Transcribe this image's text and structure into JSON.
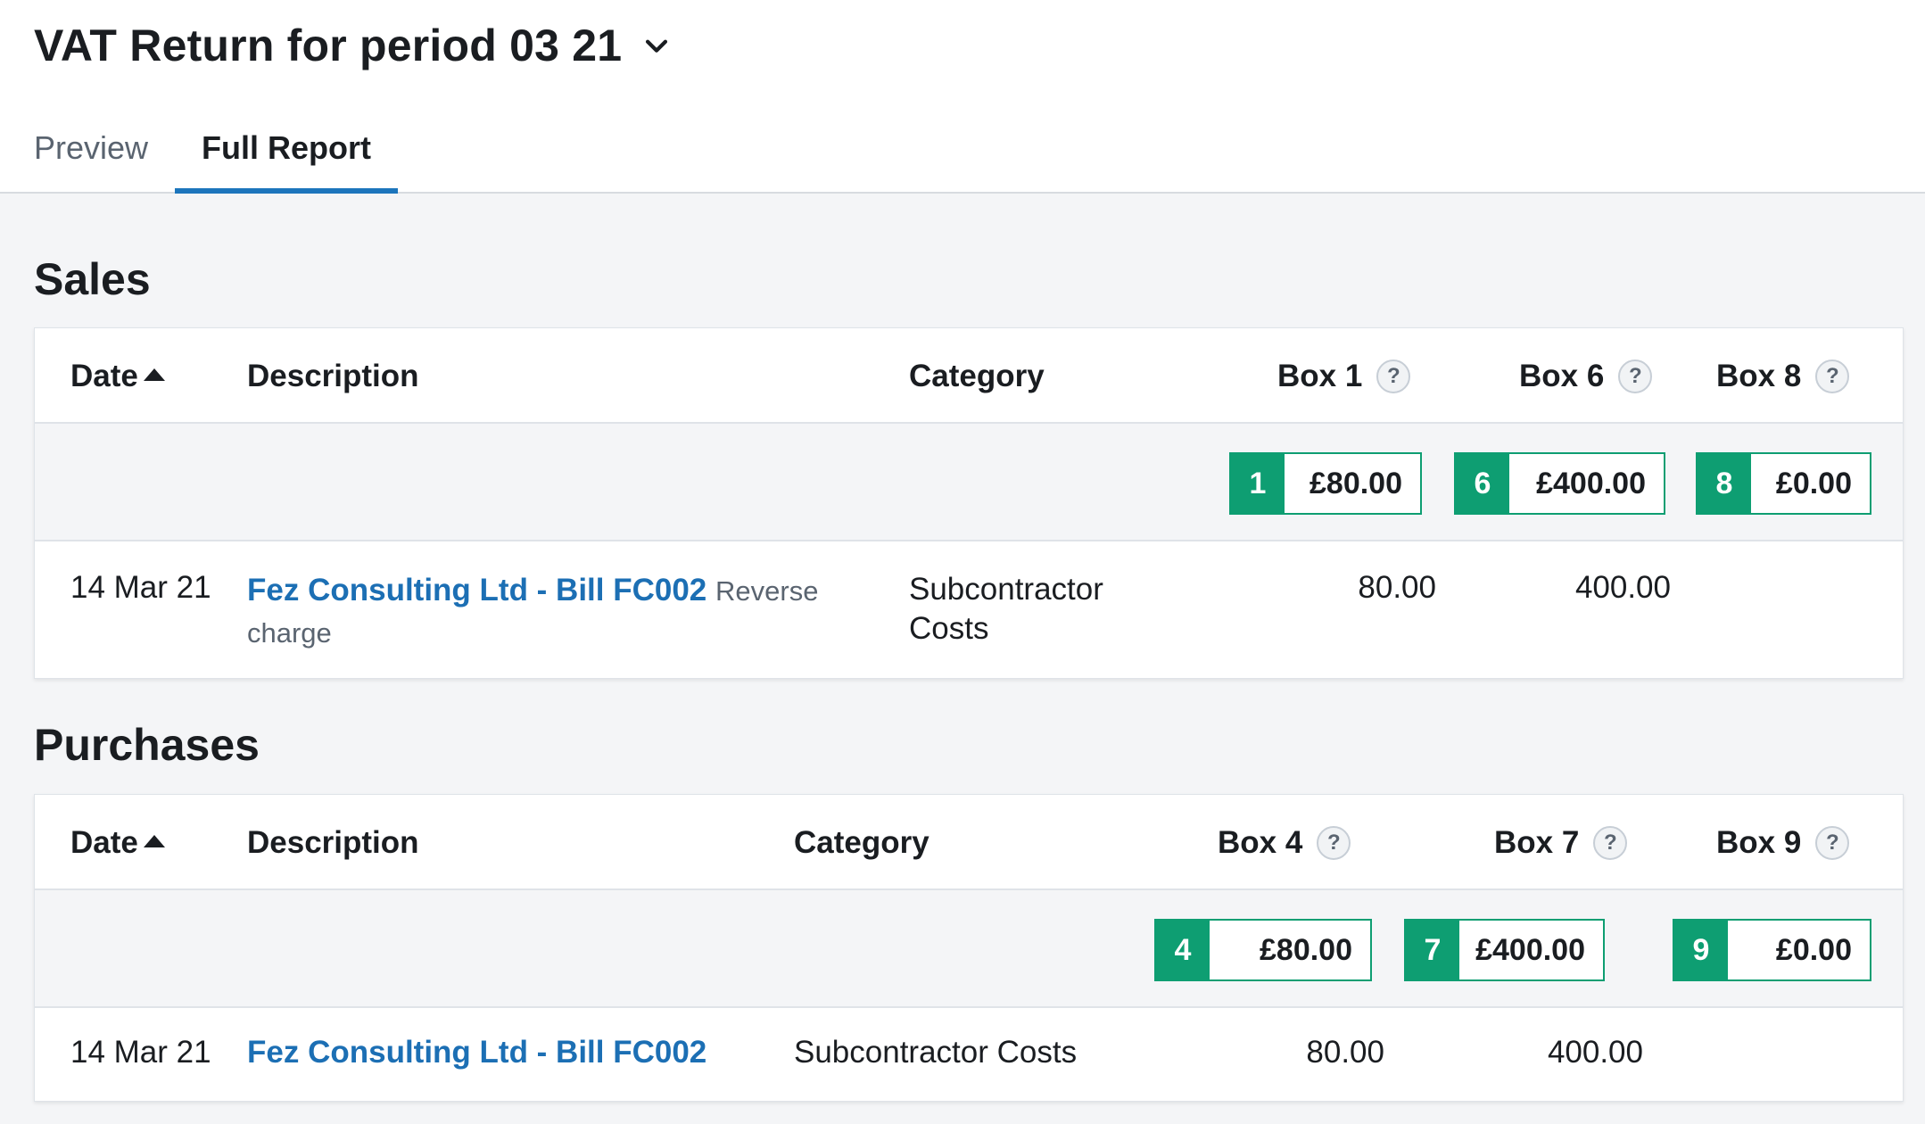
{
  "header": {
    "title": "VAT Return for period 03 21",
    "tabs": [
      {
        "label": "Preview",
        "active": false
      },
      {
        "label": "Full Report",
        "active": true
      }
    ]
  },
  "sales": {
    "title": "Sales",
    "columns": {
      "date": "Date",
      "description": "Description",
      "category": "Category",
      "box_a": "Box 1",
      "box_b": "Box 6",
      "box_c": "Box 8"
    },
    "totals": [
      {
        "box": "1",
        "amount": "£80.00"
      },
      {
        "box": "6",
        "amount": "£400.00"
      },
      {
        "box": "8",
        "amount": "£0.00"
      }
    ],
    "rows": [
      {
        "date": "14 Mar 21",
        "description": "Fez Consulting Ltd - Bill FC002",
        "note_1": "Reverse",
        "note_2": "charge",
        "category_1": "Subcontractor",
        "category_2": "Costs",
        "box_a": "80.00",
        "box_b": "400.00",
        "box_c": ""
      }
    ]
  },
  "purchases": {
    "title": "Purchases",
    "columns": {
      "date": "Date",
      "description": "Description",
      "category": "Category",
      "box_a": "Box 4",
      "box_b": "Box 7",
      "box_c": "Box 9"
    },
    "totals": [
      {
        "box": "4",
        "amount": "£80.00"
      },
      {
        "box": "7",
        "amount": "£400.00"
      },
      {
        "box": "9",
        "amount": "£0.00"
      }
    ],
    "rows": [
      {
        "date": "14 Mar 21",
        "description": "Fez Consulting Ltd - Bill FC002",
        "category": "Subcontractor Costs",
        "box_a": "80.00",
        "box_b": "400.00",
        "box_c": ""
      }
    ]
  },
  "icons": {
    "help": "?"
  },
  "colors": {
    "accent": "#1c75bc",
    "box_green": "#0e9e72",
    "link": "#1c6fb4"
  }
}
